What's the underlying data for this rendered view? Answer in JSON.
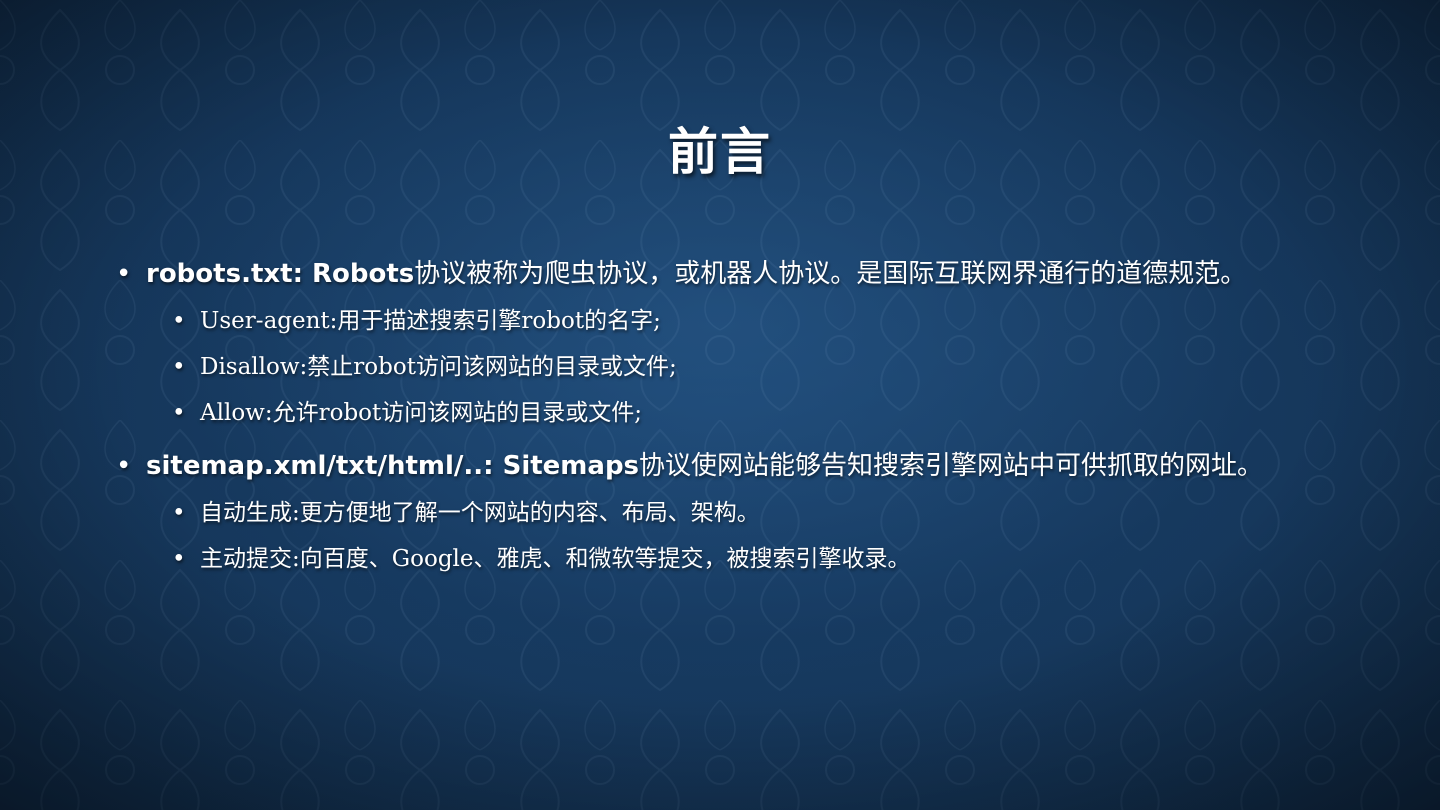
{
  "slide": {
    "title": "前言",
    "bullet_glyph": "•",
    "items": [
      {
        "lead": "robots.txt: Robots",
        "text": "协议被称为爬虫协议，或机器人协议。是国际互联网界通行的道德规范。",
        "children": [
          "User-agent:用于描述搜索引擎robot的名字;",
          "Disallow:禁止robot访问该网站的目录或文件;",
          "Allow:允许robot访问该网站的目录或文件;"
        ]
      },
      {
        "lead": "sitemap.xml/txt/html/..: Sitemaps",
        "text": "协议使网站能够告知搜索引擎网站中可供抓取的网址。",
        "children": [
          "自动生成:更方便地了解一个网站的内容、布局、架构。",
          "主动提交:向百度、Google、雅虎、和微软等提交，被搜索引擎收录。"
        ]
      }
    ]
  },
  "colors": {
    "background_center": "#1c4570",
    "background_edge": "#06142a",
    "text": "#ffffff"
  }
}
